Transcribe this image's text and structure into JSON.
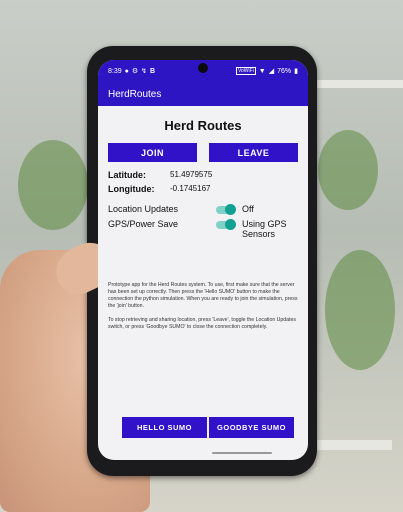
{
  "statusbar": {
    "time": "8:39",
    "left_icons": [
      "notification-icon",
      "settings-icon",
      "signal-icon"
    ],
    "left_letter": "B",
    "network_label": "VoWiFi",
    "battery": "76%"
  },
  "appbar": {
    "title": "HerdRoutes"
  },
  "main": {
    "title": "Herd Routes",
    "join_label": "JOIN",
    "leave_label": "LEAVE",
    "latitude_label": "Latitude:",
    "latitude_value": "51.4979575",
    "longitude_label": "Longitude:",
    "longitude_value": "-0.1745167",
    "location_updates_label": "Location Updates",
    "location_updates_state": "Off",
    "gps_label": "GPS/Power Save",
    "gps_state": "Using GPS Sensors",
    "desc1": "Prototype app for the Herd Routes system. To use, first make sure that the server has been set up correctly. Then press the 'Hello SUMO' button to make the connection the python simulation. When you are ready to join the simulation, press the 'join' button.",
    "desc2": "To stop retrieving and sharing location, press 'Leave', toggle the Location Updates switch, or press 'Goodbye SUMO' to close the connection completely.",
    "hello_label": "HELLO SUMO",
    "bye_label": "GOODBYE SUMO"
  },
  "colors": {
    "primary": "#3112c9",
    "appbar": "#2d15c4",
    "switch_on": "#13a092"
  }
}
